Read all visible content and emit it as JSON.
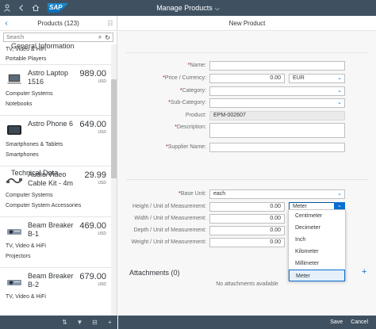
{
  "shell": {
    "app_title": "Manage Products",
    "logo_text": "SAP",
    "icons": [
      "user-icon",
      "back-icon",
      "home-icon",
      "chevron-down-icon"
    ]
  },
  "master": {
    "title": "Products (123)",
    "search_placeholder": "Search",
    "partial_item": {
      "line1": "TV, Video & HiFi",
      "line2": "Portable Players"
    },
    "items": [
      {
        "name": "Astro Laptop 1516",
        "price": "989.00",
        "currency": "USD",
        "category": "Computer Systems",
        "subcategory": "Notebooks",
        "icon": "laptop-icon"
      },
      {
        "name": "Astro Phone 6",
        "price": "649.00",
        "currency": "USD",
        "category": "Smartphones & Tablets",
        "subcategory": "Smartphones",
        "icon": "phone-icon"
      },
      {
        "name": "Audio/Video Cable Kit - 4m",
        "price": "29.99",
        "currency": "USD",
        "category": "Computer Systems",
        "subcategory": "Computer System Accessories",
        "icon": "cable-icon"
      },
      {
        "name": "Beam Breaker B-1",
        "price": "469.00",
        "currency": "USD",
        "category": "TV, Video & HiFi",
        "subcategory": "Projectors",
        "icon": "projector-icon"
      },
      {
        "name": "Beam Breaker B-2",
        "price": "679.00",
        "currency": "USD",
        "category": "TV, Video & HiFi",
        "subcategory": "",
        "icon": "projector-icon"
      }
    ],
    "footer_icons": [
      "sort-icon",
      "filter-icon",
      "group-icon",
      "add-icon"
    ]
  },
  "detail": {
    "title": "New Product",
    "general": {
      "section_title": "General Information",
      "name_label": "Name:",
      "price_label": "Price / Currency:",
      "price_value": "0.00",
      "currency_value": "EUR",
      "category_label": "Category:",
      "subcategory_label": "Sub-Category:",
      "product_label": "Product:",
      "product_value": "EPM-002607",
      "description_label": "Description:",
      "supplier_label": "Supplier Name:"
    },
    "technical": {
      "section_title": "Technical Data",
      "base_unit_label": "Base Unit:",
      "base_unit_value": "each",
      "height_label": "Height / Unit of Measurement:",
      "height_value": "0.00",
      "height_unit": "Meter",
      "width_label": "Width / Unit of Measurement:",
      "width_value": "0.00",
      "depth_label": "Depth / Unit of Measurement:",
      "depth_value": "0.00",
      "weight_label": "Weight / Unit of Measurement:",
      "weight_value": "0.00"
    },
    "unit_options": [
      "Centimeter",
      "Decimeter",
      "Inch",
      "Kilometer",
      "Millimeter",
      "Meter"
    ],
    "selected_unit": "Meter",
    "attachments_title": "Attachments (0)",
    "no_attachments": "No attachments available",
    "save_label": "Save",
    "cancel_label": "Cancel"
  },
  "colors": {
    "shell": "#3f5161",
    "accent": "#0a6ed1",
    "required": "#bb0000"
  }
}
